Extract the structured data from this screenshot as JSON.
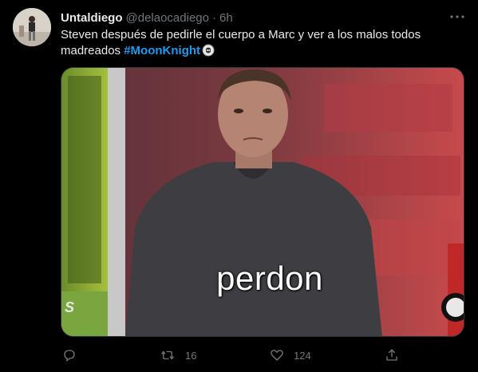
{
  "tweet": {
    "author_name": "Untaldiego",
    "handle": "@delaocadiego",
    "separator": "·",
    "time": "6h",
    "text": "Steven después de pedirle el cuerpo a Marc y ver a los malos todos madreados ",
    "hashtag": "#MoonKnight",
    "hashtag_icon": "moon-knight-emoji-icon",
    "media": {
      "caption": "perdon",
      "side_text": "S"
    }
  },
  "actions": {
    "reply_count": "",
    "retweet_count": "16",
    "like_count": "124",
    "share_count": ""
  },
  "colors": {
    "background": "#000000",
    "text": "#e7e9ea",
    "secondary": "#71767b",
    "accent": "#1d9bf0"
  }
}
